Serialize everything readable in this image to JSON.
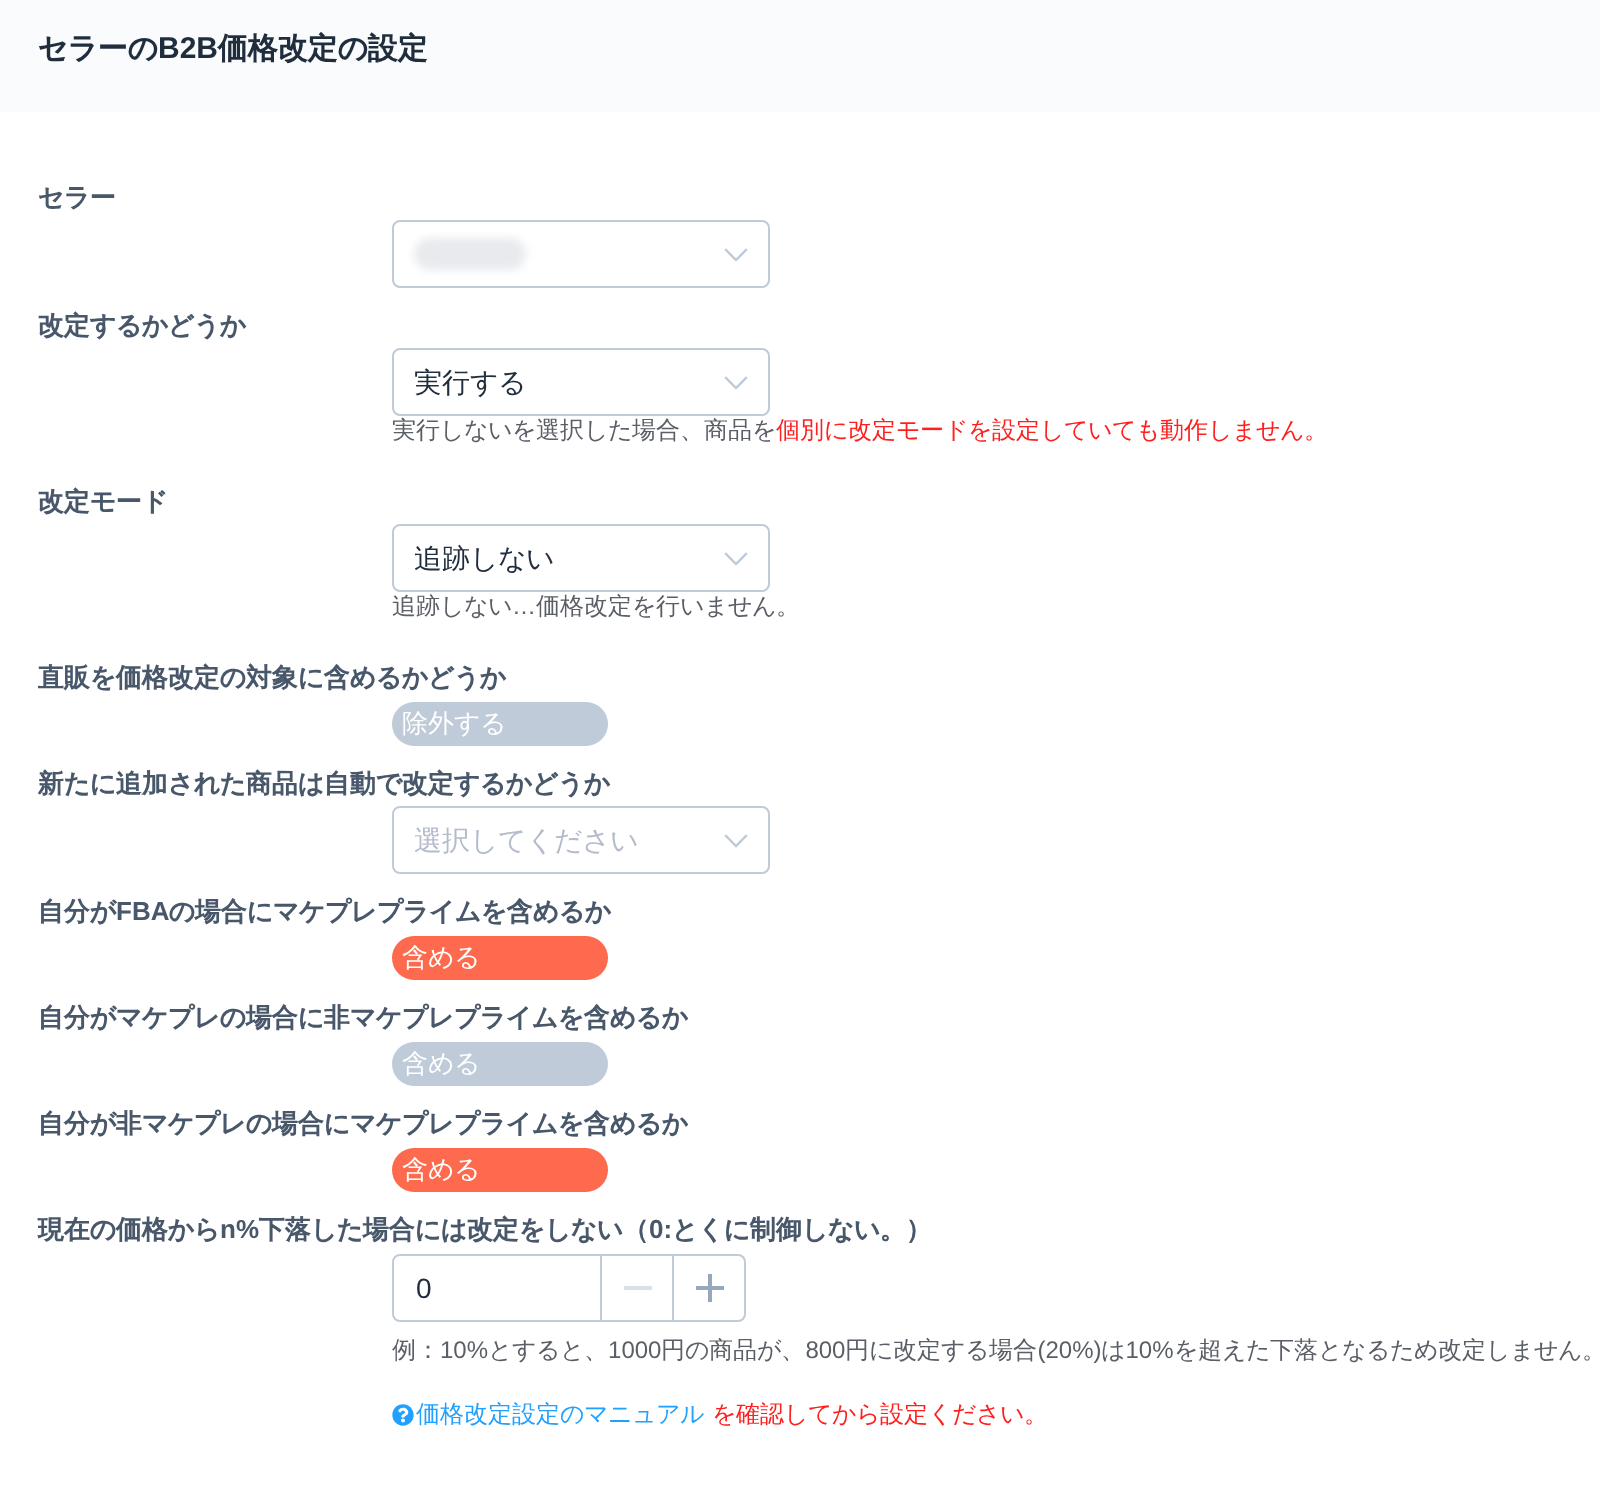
{
  "title": "セラーのB2B価格改定の設定",
  "fields": [
    {
      "label": "セラー",
      "kind": "select",
      "redacted": true
    },
    {
      "label": "改定するかどうか",
      "kind": "select",
      "value": "実行する",
      "note": [
        {
          "kind": "plain",
          "text": "実行しないを選択した場合、商品を"
        },
        {
          "kind": "warning",
          "text": "個別に改定モードを設定していても動作しません。"
        }
      ]
    },
    {
      "label": "改定モード",
      "kind": "select",
      "value": "追跡しない",
      "note": [
        {
          "kind": "plain",
          "text": "追跡しない…価格改定を行いません。"
        }
      ]
    },
    {
      "label": "直販を価格改定の対象に含めるかどうか",
      "kind": "switch",
      "on": false,
      "text": "除外する"
    },
    {
      "label": "新たに追加された商品は自動で改定するかどうか",
      "kind": "select",
      "placeholder": "選択してください"
    },
    {
      "label": "自分がFBAの場合にマケプレプライムを含めるか",
      "kind": "switch",
      "on": true,
      "text": "含める"
    },
    {
      "label": "自分がマケプレの場合に非マケプレプライムを含めるか",
      "kind": "switch",
      "on": false,
      "text": "含める"
    },
    {
      "label": "自分が非マケプレの場合にマケプレプライムを含めるか",
      "kind": "switch",
      "on": true,
      "text": "含める"
    },
    {
      "label": "現在の価格からn%下落した場合には改定をしない（0:とくに制御しない。）",
      "kind": "number",
      "value": "0",
      "buttons": [
        {
          "kind": "decrement",
          "disabled": true
        },
        {
          "kind": "increment",
          "disabled": false
        }
      ],
      "note": [
        {
          "kind": "plain",
          "text": "例：10%とすると、1000円の商品が、800円に改定する場合(20%)は10%を超えた下落となるため改定しません。"
        }
      ]
    }
  ],
  "manual_notice": {
    "link": "価格改定設定のマニュアル",
    "text": "を確認してから設定ください。"
  }
}
